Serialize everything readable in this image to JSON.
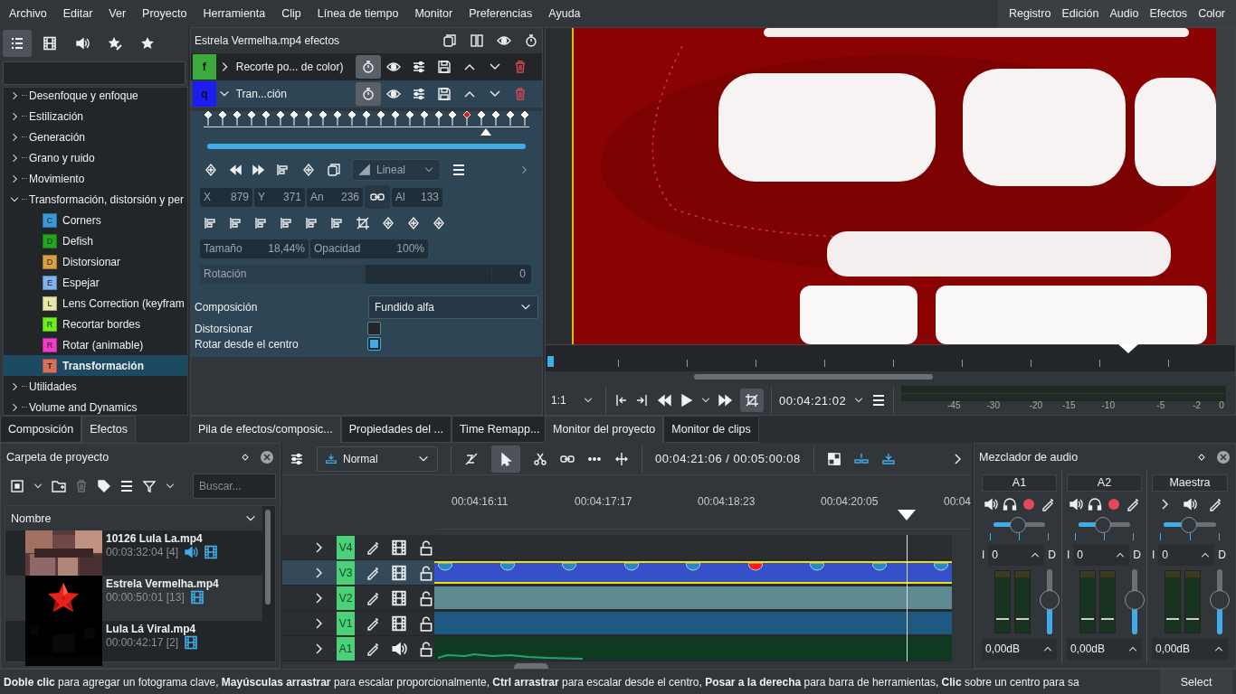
{
  "menu": [
    "Archivo",
    "Editar",
    "Ver",
    "Proyecto",
    "Herramienta",
    "Clip",
    "Línea de tiempo",
    "Monitor",
    "Preferencias",
    "Ayuda"
  ],
  "layouts": [
    "Registro",
    "Edición",
    "Audio",
    "Efectos",
    "Color"
  ],
  "effect_tree": [
    {
      "label": "Desenfoque y enfoque",
      "expanded": false
    },
    {
      "label": "Estilización",
      "expanded": false
    },
    {
      "label": "Generación",
      "expanded": false
    },
    {
      "label": "Grano y ruido",
      "expanded": false
    },
    {
      "label": "Movimiento",
      "expanded": false
    },
    {
      "label": "Transformación, distorsión y per",
      "expanded": true,
      "children": [
        {
          "label": "Corners",
          "letter": "C",
          "color": "#3a9ad9",
          "selected": false
        },
        {
          "label": "Defish",
          "letter": "D",
          "color": "#22a61c",
          "selected": false
        },
        {
          "label": "Distorsionar",
          "letter": "D",
          "color": "#d8a13e",
          "selected": false
        },
        {
          "label": "Espejar",
          "letter": "E",
          "color": "#7fb3f0",
          "selected": false
        },
        {
          "label": "Lens Correction  (keyfram",
          "letter": "L",
          "color": "#e6e6a8",
          "selected": false
        },
        {
          "label": "Recortar bordes",
          "letter": "R",
          "color": "#6ef01c",
          "selected": false
        },
        {
          "label": "Rotar (animable)",
          "letter": "R",
          "color": "#f03cc8",
          "selected": false
        },
        {
          "label": "Transformación",
          "letter": "T",
          "color": "#d9705a",
          "selected": true
        }
      ]
    },
    {
      "label": "Utilidades",
      "expanded": false
    },
    {
      "label": "Volume and Dynamics",
      "expanded": false
    }
  ],
  "effect_stack": {
    "title": "Estrela Vermelha.mp4 efectos",
    "effects": [
      {
        "letter": "f",
        "color": "#3daa3d",
        "label": "Recorte po... de color)",
        "expanded": false
      },
      {
        "letter": "q",
        "color": "#1c1cf0",
        "label": "Tran...ción",
        "expanded": true
      }
    ],
    "keyframes": [
      {
        "selected": false
      },
      {
        "selected": false
      },
      {
        "selected": false
      },
      {
        "selected": false
      },
      {
        "selected": false
      },
      {
        "selected": false
      },
      {
        "selected": false
      },
      {
        "selected": false
      },
      {
        "selected": false
      },
      {
        "selected": false
      },
      {
        "selected": false
      },
      {
        "selected": false
      },
      {
        "selected": false
      },
      {
        "selected": false
      },
      {
        "selected": false
      },
      {
        "selected": false
      },
      {
        "selected": false
      },
      {
        "selected": false
      },
      {
        "selected": true
      },
      {
        "selected": false
      },
      {
        "selected": false
      },
      {
        "selected": false
      },
      {
        "selected": false
      }
    ],
    "interpolation": "Lineal",
    "controls_disabled": true,
    "geometry": [
      {
        "label": "X",
        "value": "879"
      },
      {
        "label": "Y",
        "value": "371"
      },
      {
        "label": "An",
        "value": "236"
      },
      {
        "label": "Al",
        "value": "133"
      }
    ],
    "size": {
      "label": "Tamaño",
      "value": "18,44%"
    },
    "opacity": {
      "label": "Opacidad",
      "value": "100%"
    },
    "rotation": {
      "label": "Rotación",
      "value": "0",
      "level": 0.5
    },
    "composition": {
      "label": "Composición",
      "value": "Fundido alfa"
    },
    "options": [
      {
        "label": "Distorsionar",
        "checked": false
      },
      {
        "label": "Rotar desde el centro",
        "checked": true
      }
    ]
  },
  "monitor": {
    "zoom": "1:1",
    "timecode": "00:04:21:02",
    "meter_scale": [
      "-45",
      "-30",
      "-20",
      "-15",
      "-10",
      "-5",
      "-2",
      "0"
    ]
  },
  "left_tabs": [
    {
      "label": "Composición",
      "selected": false
    },
    {
      "label": "Efectos",
      "selected": true
    }
  ],
  "stack_tabs": [
    {
      "label": "Pila de efectos/composic...",
      "selected": true
    },
    {
      "label": "Propiedades del ...",
      "selected": false
    },
    {
      "label": "Time Remapp...",
      "selected": false
    }
  ],
  "monitor_tabs": [
    {
      "label": "Monitor del proyecto",
      "selected": true
    },
    {
      "label": "Monitor de clips",
      "selected": false
    }
  ],
  "bin": {
    "title": "Carpeta de proyecto",
    "placeholder": "Buscar...",
    "column": "Nombre",
    "items": [
      {
        "name": "10126 Lula La.mp4",
        "info": "00:03:32:04 [4]",
        "audio": true,
        "video": true,
        "selected": false,
        "kind": "picture"
      },
      {
        "name": "Estrela Vermelha.mp4",
        "info": "00:00:50:01 [13]",
        "audio": false,
        "video": true,
        "selected": true,
        "kind": "picture"
      },
      {
        "name": "Lula Lá Viral.mp4",
        "info": "00:00:42:17 [2]",
        "audio": false,
        "video": true,
        "selected": false,
        "kind": "picture"
      }
    ]
  },
  "timeline": {
    "mode": "Normal",
    "timecode": "00:04:21:06 / 00:05:00:08",
    "ruler": [
      "00:04:16:11",
      "00:04:17:17",
      "00:04:18:23",
      "00:04:20:05",
      "00:04"
    ],
    "tracks": [
      {
        "name": "V4",
        "kind": "video",
        "selected": false
      },
      {
        "name": "V3",
        "kind": "video",
        "selected": true,
        "clip": {
          "color": "#3550c8",
          "markers": [
            {
              "selected": false
            },
            {
              "selected": false
            },
            {
              "selected": false
            },
            {
              "selected": false
            },
            {
              "selected": false
            },
            {
              "selected": true
            },
            {
              "selected": false
            },
            {
              "selected": false
            },
            {
              "selected": false
            }
          ]
        }
      },
      {
        "name": "V2",
        "kind": "video",
        "selected": false,
        "clip": {
          "color": "#5f8a92"
        }
      },
      {
        "name": "V1",
        "kind": "video",
        "selected": false,
        "clip": {
          "color": "#1f5880"
        }
      },
      {
        "name": "A1",
        "kind": "audio",
        "selected": false,
        "clip": {
          "color": "#0e3a20"
        }
      }
    ]
  },
  "mixer": {
    "title": "Mezclador de audio",
    "channels": [
      {
        "name": "A1",
        "kind": "track",
        "pan": {
          "level": 0.48
        },
        "left": "I",
        "balance": "0",
        "right": "D",
        "fader": {
          "level": 0.55
        },
        "volume": "0,00dB"
      },
      {
        "name": "A2",
        "kind": "track",
        "pan": {
          "level": 0.48
        },
        "left": "I",
        "balance": "0",
        "right": "D",
        "fader": {
          "level": 0.55
        },
        "volume": "0,00dB"
      },
      {
        "name": "Maestra",
        "kind": "master",
        "pan": {
          "level": 0.48
        },
        "left": "I",
        "balance": "0",
        "right": "D",
        "fader": {
          "level": 0.55
        },
        "volume": "0,00dB"
      }
    ]
  },
  "status": {
    "text": "**Doble clic** para agregar un fotograma clave, **Mayúsculas arrastrar** para escalar proporcionalmente, **Ctrl arrastrar** para escalar desde el centro, **Posar a la derecha** para barra de herramientas, **Clic** sobre un centro para sa",
    "button": "Select"
  }
}
